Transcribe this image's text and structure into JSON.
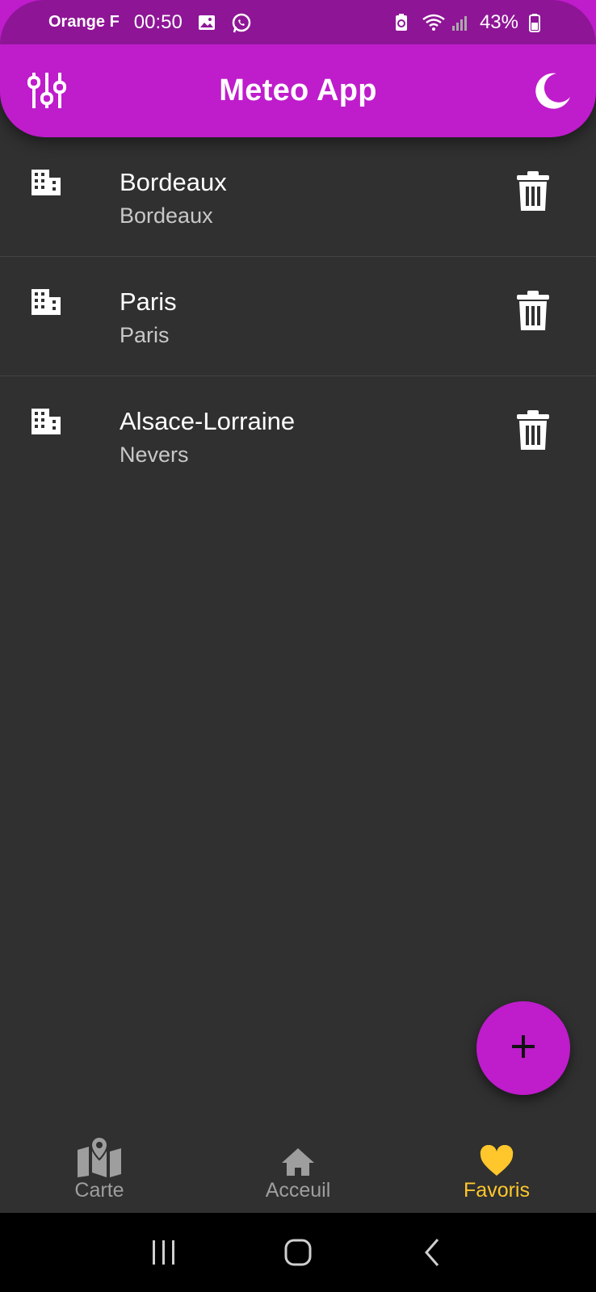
{
  "status_bar": {
    "carrier": "Orange F",
    "time": "00:50",
    "battery": "43%"
  },
  "app_bar": {
    "title": "Meteo App",
    "left_icon": "sliders-icon",
    "right_icon": "moon-icon"
  },
  "favorites": [
    {
      "title": "Bordeaux",
      "subtitle": "Bordeaux",
      "icon": "building-icon"
    },
    {
      "title": "Paris",
      "subtitle": "Paris",
      "icon": "building-icon"
    },
    {
      "title": "Alsace-Lorraine",
      "subtitle": "Nevers",
      "icon": "building-icon"
    }
  ],
  "fab": {
    "icon": "plus-icon"
  },
  "bottom_nav": {
    "items": [
      {
        "label": "Carte",
        "icon": "map-icon",
        "active": false
      },
      {
        "label": "Acceuil",
        "icon": "home-icon",
        "active": false
      },
      {
        "label": "Favoris",
        "icon": "heart-icon",
        "active": true
      }
    ]
  },
  "colors": {
    "primary": "#bf1ccc",
    "status_bar": "#8e1596",
    "background": "#303030",
    "active_nav": "#ffc72c",
    "inactive_nav": "#9e9e9e"
  }
}
